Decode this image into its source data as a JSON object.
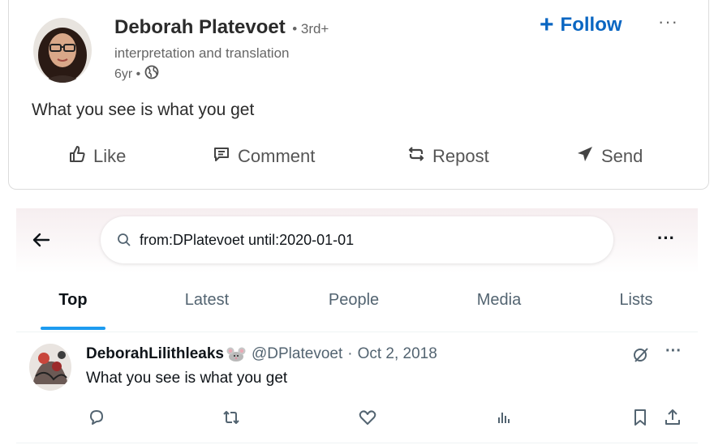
{
  "linkedin": {
    "author_name": "Deborah Platevoet",
    "degree": "• 3rd+",
    "headline": "interpretation and translation",
    "age": "6yr •",
    "follow_label": "Follow",
    "post_text": "What you see is what you get",
    "actions": [
      {
        "label": "Like",
        "icon": "thumbs-up-icon"
      },
      {
        "label": "Comment",
        "icon": "comment-icon"
      },
      {
        "label": "Repost",
        "icon": "repost-icon"
      },
      {
        "label": "Send",
        "icon": "send-icon"
      }
    ],
    "accent_color": "#0a66c2"
  },
  "x": {
    "search_query": "from:DPlatevoet until:2020-01-01",
    "tabs": [
      "Top",
      "Latest",
      "People",
      "Media",
      "Lists"
    ],
    "active_tab": "Top",
    "tweet": {
      "display_name": "DeborahLilithleaks",
      "handle": "@DPlatevoet",
      "dot": "·",
      "date": "Oct 2, 2018",
      "text": "What you see is what you get"
    },
    "actions": [
      "reply-icon",
      "retweet-icon",
      "like-icon",
      "views-icon",
      "bookmark-icon",
      "share-icon"
    ],
    "accent_color": "#1d9bf0"
  }
}
